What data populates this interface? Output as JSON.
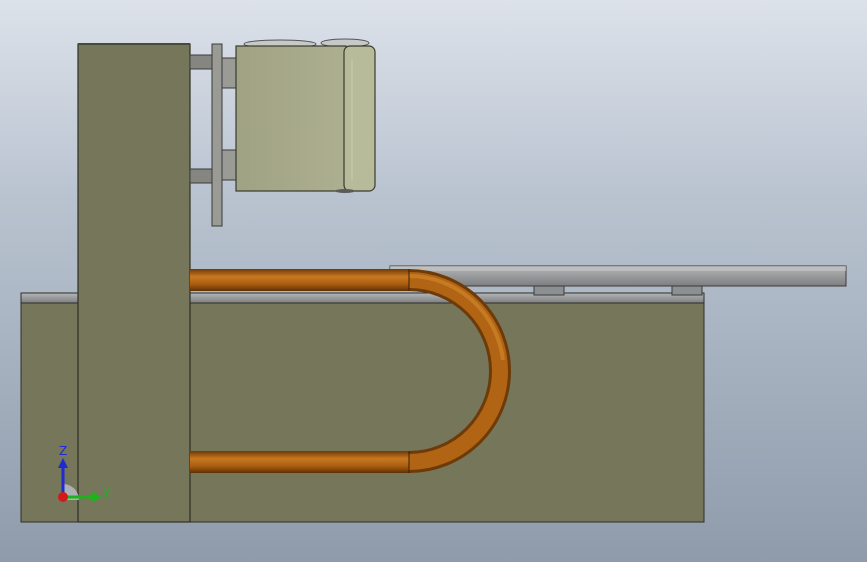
{
  "viewport": {
    "description_colors": {
      "body": "#75765a",
      "body_edge": "#2f2f25",
      "top_plate": "#8a8c88",
      "rail": "#9b9d9f",
      "motor_body": "#a9ab8c",
      "motor_face": "#bcbf9e",
      "bracket": "#858680",
      "pipe": "#a85c10",
      "pipe_highlight": "#c9781f"
    }
  },
  "triad": {
    "z_label": "Z",
    "y_label": "Y",
    "z_color": "#1f2bd1",
    "y_color": "#1db31d",
    "x_color": "#d11a1a"
  }
}
